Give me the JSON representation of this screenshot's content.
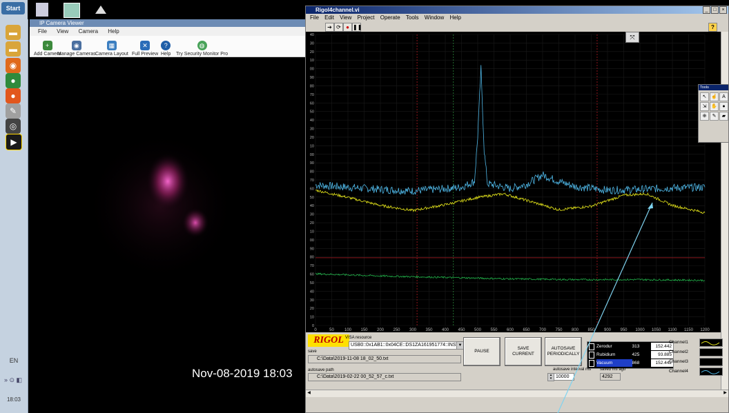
{
  "taskbar": {
    "start_label": "Start",
    "language": "EN",
    "clock": "18:03"
  },
  "camera_viewer": {
    "title": "IP Camera Viewer",
    "menu": [
      "File",
      "View",
      "Camera",
      "Help"
    ],
    "toolbar": [
      {
        "label": "Add Camera",
        "icon": "add-camera-icon"
      },
      {
        "label": "Manage Cameras",
        "icon": "manage-cameras-icon"
      },
      {
        "label": "Camera Layout",
        "icon": "camera-layout-icon"
      },
      {
        "label": "Full Preview",
        "icon": "full-preview-icon"
      },
      {
        "label": "Help",
        "icon": "help-icon"
      },
      {
        "label": "Try Security Monitor Pro",
        "icon": "globe-icon"
      }
    ],
    "timestamp": "Nov-08-2019 18:03"
  },
  "labview": {
    "title": "Rigol4channel.vi",
    "menu": [
      "File",
      "Edit",
      "View",
      "Project",
      "Operate",
      "Tools",
      "Window",
      "Help"
    ],
    "logo_text": "RIGOL",
    "visa_label": "VISA resource",
    "visa_value": "USB0::0x1AB1::0x04CE::DS1ZA161951774::INSTR",
    "save_path_label": "save",
    "save_path": "C:\\Data\\2019-11-08 18_02_50.txt",
    "autosave_path_label": "autosave path",
    "autosave_path": "C:\\Data\\2019-02-22 00_52_57_c.txt",
    "buttons": {
      "pause": "PAUSE",
      "save_current": "SAVE\nCURRENT",
      "autosave": "AUTOSAVE\nPERIODICALLY"
    },
    "autosave_interval_label": "autosave interval ms",
    "autosave_interval": "10000",
    "saved_ago_label": "saved ms ago",
    "saved_ago": "4292",
    "materials": [
      {
        "name": "Zerodur",
        "count": "313",
        "value": "152.442"
      },
      {
        "name": "Rubidium",
        "count": "425",
        "value": "93.885"
      },
      {
        "name": "Vacuum",
        "count": "868",
        "value": "152.442"
      }
    ],
    "channels": [
      "Channel1",
      "Channel2",
      "Channel3",
      "Channel4"
    ],
    "tools_palette_title": "Tools"
  },
  "chart_data": {
    "type": "line",
    "x_ticks": [
      0,
      50,
      100,
      150,
      200,
      250,
      300,
      350,
      400,
      450,
      500,
      550,
      600,
      650,
      700,
      750,
      800,
      850,
      900,
      950,
      1000,
      1050,
      1100,
      1150,
      1200
    ],
    "y_tick_labels": [
      "0",
      "10",
      "20",
      "30",
      "40",
      "50",
      "60",
      "70",
      "80",
      "90",
      "00",
      "10",
      "20",
      "30",
      "40",
      "50",
      "60",
      "70",
      "80",
      "90",
      "00",
      "10",
      "20",
      "30",
      "40",
      "50",
      "60",
      "70",
      "80",
      "90",
      "00",
      "10",
      "20",
      "30",
      "40"
    ],
    "xlim": [
      0,
      1200
    ],
    "ylim": [
      0,
      40
    ],
    "cursors": {
      "red": [
        313,
        868
      ],
      "green": [
        425
      ]
    },
    "series": [
      {
        "color": "#4fb8e8",
        "values_desc": "noisy baseline ~19 with peak ~35 at x≈510",
        "points": [
          [
            0,
            19.3
          ],
          [
            100,
            19.0
          ],
          [
            200,
            18.7
          ],
          [
            300,
            18.5
          ],
          [
            400,
            18.8
          ],
          [
            450,
            19.0
          ],
          [
            490,
            19.8
          ],
          [
            500,
            26
          ],
          [
            510,
            35.3
          ],
          [
            520,
            24
          ],
          [
            530,
            19.5
          ],
          [
            600,
            18.8
          ],
          [
            650,
            19.4
          ],
          [
            700,
            20.7
          ],
          [
            750,
            19.8
          ],
          [
            800,
            19.1
          ],
          [
            900,
            18.6
          ],
          [
            1000,
            18.7
          ],
          [
            1100,
            18.9
          ],
          [
            1200,
            19.0
          ]
        ]
      },
      {
        "color": "#e6e61a",
        "points": [
          [
            0,
            18.6
          ],
          [
            100,
            17.6
          ],
          [
            200,
            16.5
          ],
          [
            300,
            15.8
          ],
          [
            400,
            16.6
          ],
          [
            500,
            17.6
          ],
          [
            580,
            18.1
          ],
          [
            650,
            17.2
          ],
          [
            750,
            15.9
          ],
          [
            850,
            16.4
          ],
          [
            950,
            17.9
          ],
          [
            1020,
            18.1
          ],
          [
            1100,
            16.5
          ],
          [
            1200,
            15.5
          ]
        ]
      },
      {
        "color": "#22b04a",
        "points": [
          [
            0,
            7.1
          ],
          [
            200,
            6.8
          ],
          [
            400,
            6.6
          ],
          [
            600,
            6.4
          ],
          [
            800,
            6.3
          ],
          [
            1000,
            6.3
          ],
          [
            1200,
            6.2
          ]
        ]
      },
      {
        "color": "#b01820",
        "points": [
          [
            0,
            9.3
          ],
          [
            1200,
            9.3
          ]
        ]
      }
    ]
  }
}
